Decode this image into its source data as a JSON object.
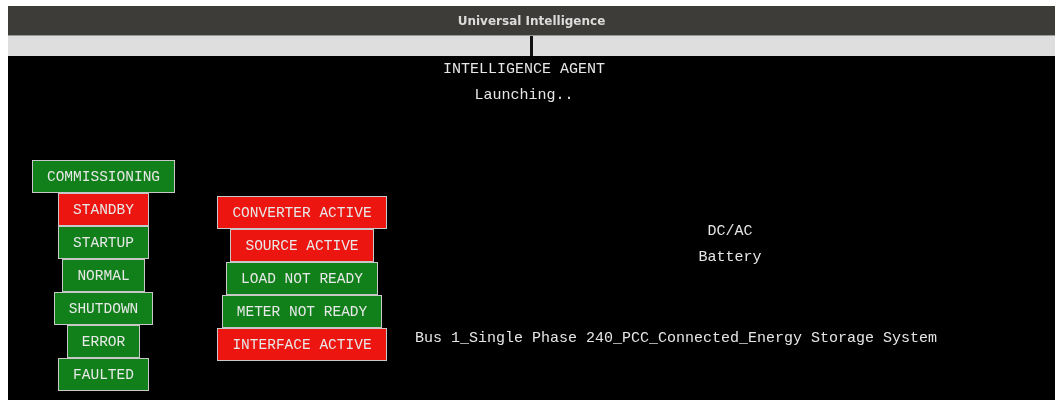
{
  "window": {
    "title": "Universal Intelligence"
  },
  "header": {
    "title": "INTELLIGENCE AGENT",
    "status": "Launching.."
  },
  "state_column": [
    {
      "label": "COMMISSIONING",
      "color": "#11801b"
    },
    {
      "label": "STANDBY",
      "color": "#ec1510"
    },
    {
      "label": "STARTUP",
      "color": "#11801b"
    },
    {
      "label": "NORMAL",
      "color": "#11801b"
    },
    {
      "label": "SHUTDOWN",
      "color": "#11801b"
    },
    {
      "label": "ERROR",
      "color": "#11801b"
    },
    {
      "label": "FAULTED",
      "color": "#11801b"
    }
  ],
  "flag_column": [
    {
      "label": "CONVERTER ACTIVE",
      "color": "#ec1510"
    },
    {
      "label": "SOURCE ACTIVE",
      "color": "#ec1510"
    },
    {
      "label": "LOAD NOT READY",
      "color": "#11801b"
    },
    {
      "label": "METER NOT READY",
      "color": "#11801b"
    },
    {
      "label": "INTERFACE ACTIVE",
      "color": "#ec1510"
    }
  ],
  "device": {
    "type": "DC/AC",
    "name": "Battery",
    "system": "Bus 1_Single Phase 240_PCC_Connected_Energy Storage System"
  }
}
